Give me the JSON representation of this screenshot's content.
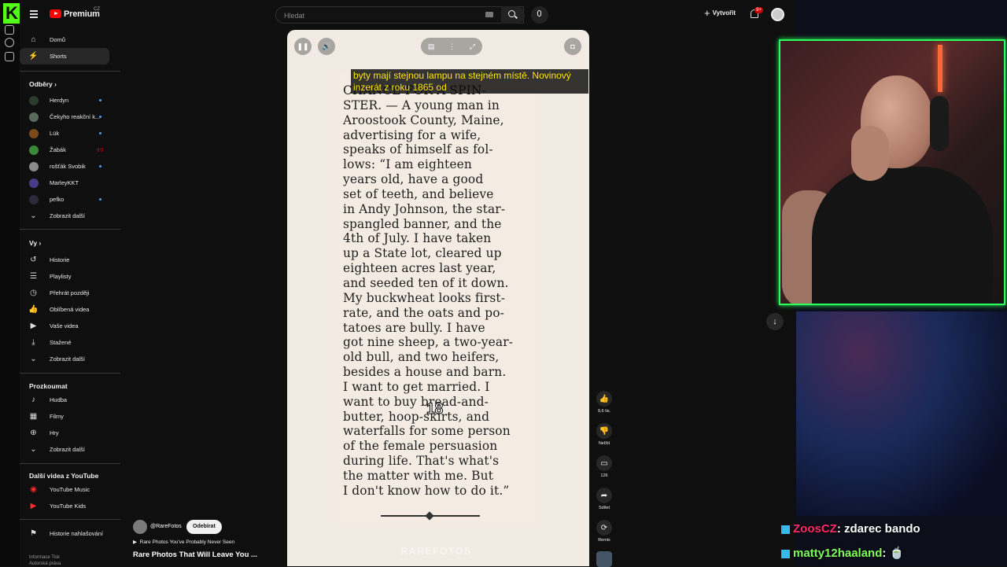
{
  "topbar": {
    "brand": "Premium",
    "brand_region": "CZ",
    "search_placeholder": "Hledat",
    "create_label": "Vytvořit",
    "notification_count": "9+"
  },
  "sidebar": {
    "main": [
      {
        "label": "Domů",
        "icon": "home-icon"
      },
      {
        "label": "Shorts",
        "icon": "shorts-icon",
        "active": true
      }
    ],
    "subs_heading": "Odběry",
    "subscriptions": [
      {
        "label": "Herdyn",
        "indicator": "dot"
      },
      {
        "label": "Čekyho reakční k...",
        "indicator": "dot"
      },
      {
        "label": "Lük",
        "indicator": "dot"
      },
      {
        "label": "Žabák",
        "indicator": "live"
      },
      {
        "label": "rošťák Svobik",
        "indicator": "dot"
      },
      {
        "label": "MarleyKKT",
        "indicator": ""
      },
      {
        "label": "pefko",
        "indicator": "dot"
      },
      {
        "label": "Zobrazit další",
        "indicator": ""
      }
    ],
    "you_heading": "Vy",
    "you": [
      {
        "label": "Historie",
        "icon": "history-icon"
      },
      {
        "label": "Playlisty",
        "icon": "playlists-icon"
      },
      {
        "label": "Přehrát později",
        "icon": "watch-later-icon"
      },
      {
        "label": "Oblíbená videa",
        "icon": "liked-icon"
      },
      {
        "label": "Vaše videa",
        "icon": "your-videos-icon"
      },
      {
        "label": "Stažené",
        "icon": "downloads-icon"
      },
      {
        "label": "Zobrazit další",
        "icon": "chevron-down-icon"
      }
    ],
    "explore_heading": "Prozkoumat",
    "explore": [
      {
        "label": "Hudba",
        "icon": "music-icon"
      },
      {
        "label": "Filmy",
        "icon": "movies-icon"
      },
      {
        "label": "Hry",
        "icon": "gaming-icon"
      },
      {
        "label": "Zobrazit další",
        "icon": "chevron-down-icon"
      }
    ],
    "more_heading": "Další videa z YouTube",
    "more": [
      {
        "label": "YouTube Music",
        "icon": "youtube-music-icon"
      },
      {
        "label": "YouTube Kids",
        "icon": "youtube-kids-icon"
      }
    ],
    "report_label": "Historie nahlašování",
    "footer_line1": "Informace Tisk",
    "footer_line2": "Autorská práva"
  },
  "short": {
    "subtitle": "byty mají stejnou lampu na stejném místě. Novinový inzerát z roku 1865 od",
    "article_lines": [
      "CHANCE FOR A SPIN-",
      "STER. — A young man in",
      "Aroostook County, Maine,",
      "advertising for a wife,",
      "speaks of himself as fol-",
      "lows: “I am eighteen",
      "years old, have a good",
      "set of teeth, and believe",
      "in Andy Johnson, the star-",
      "spangled banner, and the",
      "4th of July. I have taken",
      "up a State lot, cleared up",
      "eighteen acres last year,",
      "and seeded ten of it down.",
      "My buckwheat looks first-",
      "rate, and the oats and po-",
      "tatoes are bully. I have",
      "got nine sheep, a two-year-",
      "old bull, and two heifers,",
      "besides a house and barn.",
      "I want to get married. I",
      "want to buy bread-and-",
      "butter, hoop-skirts, and",
      "waterfalls for some person",
      "of the female persuasion",
      "during life. That's what's",
      "the matter with me. But",
      "I don't know how to do it.”"
    ],
    "overlay_number": "18",
    "watermark": "RAREFOTOS",
    "channel": "@RareFotos",
    "subscribe_label": "Odebírat",
    "playlist": "Rare Photos You've Probably Never Seen",
    "title": "Rare Photos That Will Leave You ..."
  },
  "actions": {
    "like_count": "9,6 tis.",
    "dislike_label": "Nelíbí",
    "comment_count": "126",
    "share_label": "Sdílet",
    "remix_label": "Remix"
  },
  "chat": [
    {
      "user": "ZoosCZ",
      "message": ": zdarec bando"
    },
    {
      "user": "matty12haaland",
      "message": ": 🍵"
    }
  ],
  "colors": {
    "accent": "#ff0000",
    "webcam_border": "#2bff5a",
    "kick_green": "#53fc18",
    "subtitle": "#ffe600"
  }
}
